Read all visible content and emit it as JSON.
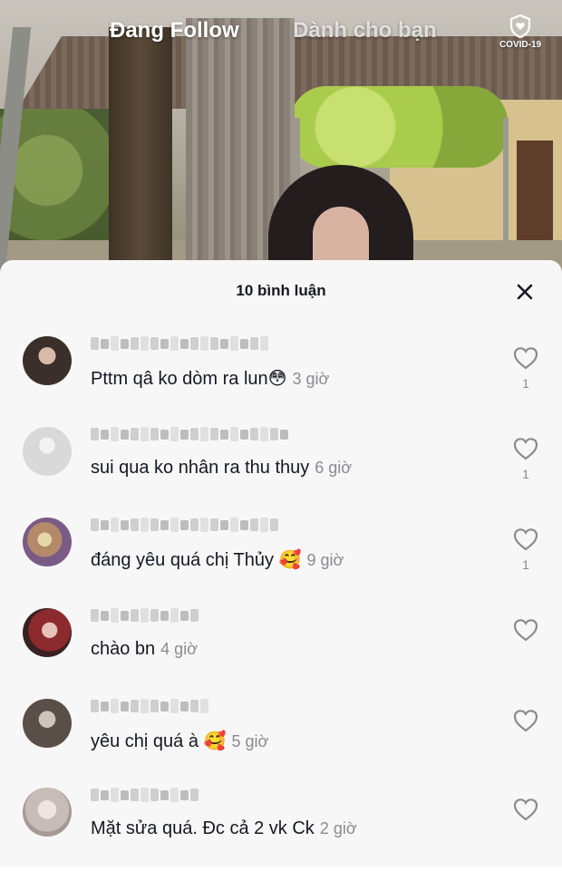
{
  "top_nav": {
    "following_label": "Đang Follow",
    "for_you_label": "Dành cho bạn",
    "covid_label": "COVID-19"
  },
  "comments_sheet": {
    "title": "10 bình luận",
    "close_icon": "close-icon",
    "comments": [
      {
        "text": "Pttm qâ ko dòm ra lun",
        "emoji": "😳",
        "time": "3 giờ",
        "likes": "1",
        "avatar_color": "#3b2f2b"
      },
      {
        "text": "sui qua ko nhân ra thu thuy",
        "emoji": "",
        "time": "6 giờ",
        "likes": "1",
        "avatar_color": "#d9d9d9"
      },
      {
        "text": "đáng yêu quá chị Thủy ",
        "emoji": "🥰",
        "time": "9 giờ",
        "likes": "1",
        "avatar_color": "#b48a6a"
      },
      {
        "text": "chào bn",
        "emoji": "",
        "time": "4 giờ",
        "likes": "",
        "avatar_color": "#8c2a2e"
      },
      {
        "text": "yêu chị quá à ",
        "emoji": "🥰",
        "time": "5 giờ",
        "likes": "",
        "avatar_color": "#5a4e48"
      },
      {
        "text": "Mặt sửa quá. Đc cả 2 vk Ck",
        "emoji": "",
        "time": "2 giờ",
        "likes": "",
        "avatar_color": "#c8bcb8"
      }
    ]
  },
  "colors": {
    "sheet_background": "#f7f7f7",
    "text_primary": "#161823",
    "text_secondary": "#8a8b91"
  }
}
